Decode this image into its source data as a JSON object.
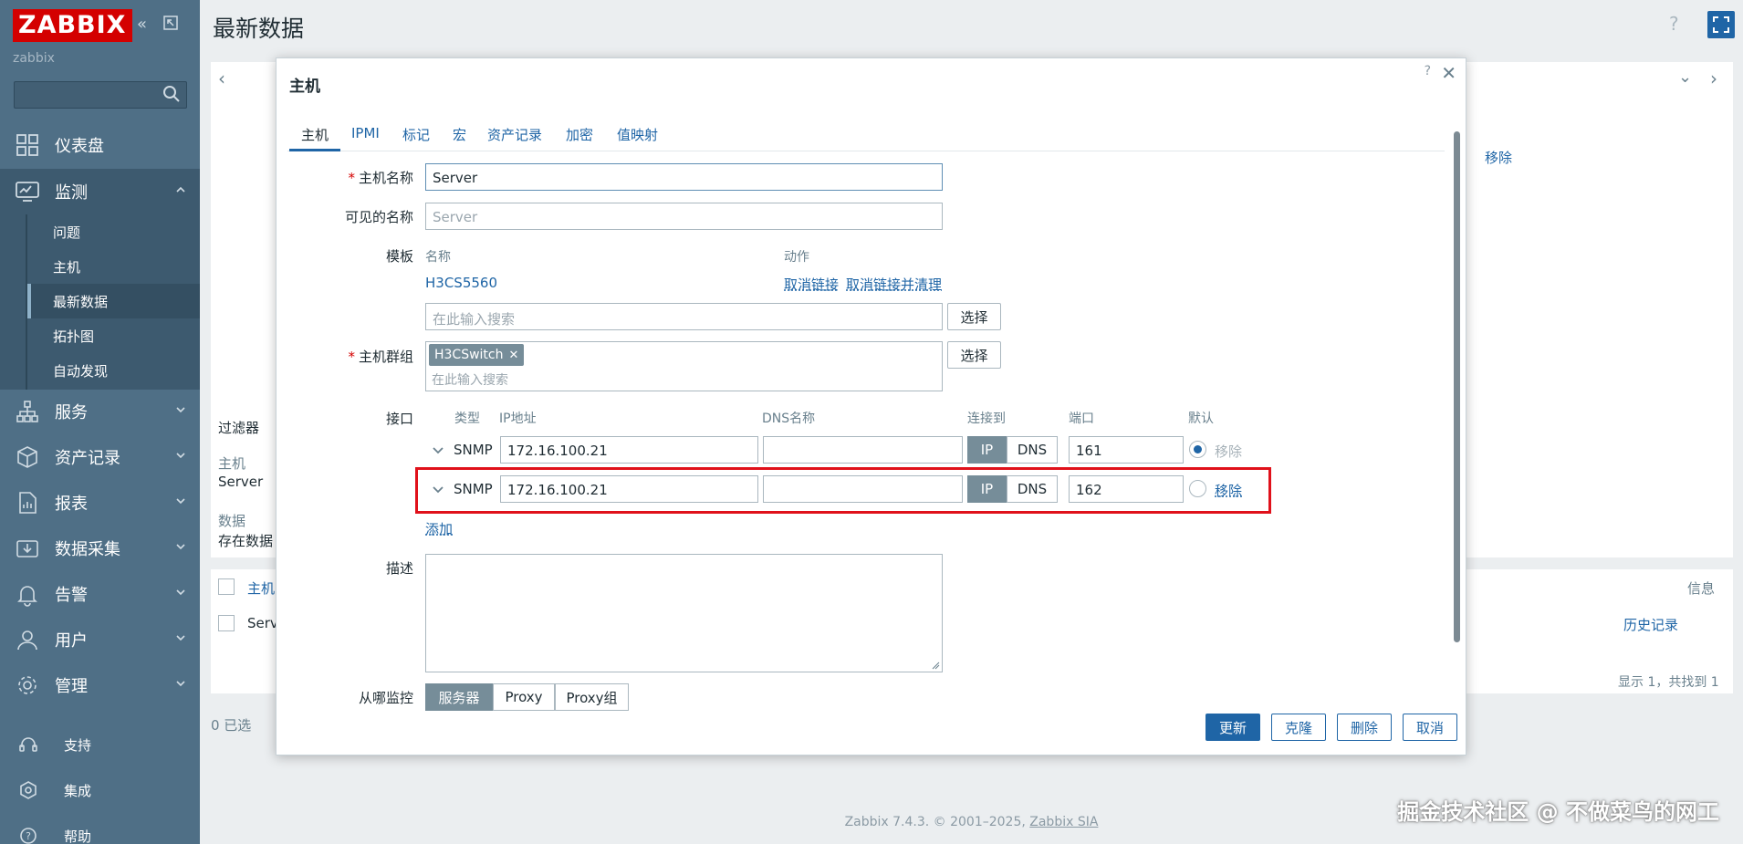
{
  "sidebar": {
    "logo": "ZABBIX",
    "server_name": "zabbix",
    "menu": [
      {
        "label": "仪表盘",
        "icon": "dashboard-icon"
      },
      {
        "label": "监测",
        "icon": "monitoring-icon"
      },
      {
        "label": "服务",
        "icon": "services-icon"
      },
      {
        "label": "资产记录",
        "icon": "inventory-icon"
      },
      {
        "label": "报表",
        "icon": "reports-icon"
      },
      {
        "label": "数据采集",
        "icon": "data-collection-icon"
      },
      {
        "label": "告警",
        "icon": "alerts-icon"
      },
      {
        "label": "用户",
        "icon": "users-icon"
      },
      {
        "label": "管理",
        "icon": "administration-icon"
      }
    ],
    "submenu": [
      "问题",
      "主机",
      "最新数据",
      "拓扑图",
      "自动发现"
    ],
    "bottom": [
      {
        "label": "支持",
        "icon": "support-icon"
      },
      {
        "label": "集成",
        "icon": "integrations-icon"
      },
      {
        "label": "帮助",
        "icon": "help-icon"
      }
    ]
  },
  "page": {
    "title": "最新数据",
    "filter_label": "过滤器",
    "bg_host_label": "主机",
    "bg_host_value": "Server",
    "bg_data_label": "数据",
    "bg_data_value": "存在数据",
    "bg_remove": "移除",
    "bg_table_host": "主机",
    "bg_table_info": "信息",
    "bg_row_host": "Serv",
    "bg_history": "历史记录",
    "bg_count": "显示 1，共找到 1",
    "bg_selected": "0 已选",
    "footer": "Zabbix 7.4.3. © 2001–2025,",
    "footer_link": "Zabbix SIA",
    "watermark": "掘金技术社区 @ 不做菜鸟的网工"
  },
  "dialog": {
    "title": "主机",
    "tabs": [
      "主机",
      "IPMI",
      "标记",
      "宏",
      "资产记录",
      "加密",
      "值映射"
    ],
    "host_name_label": "主机名称",
    "host_name_value": "Server",
    "visible_name_label": "可见的名称",
    "visible_name_placeholder": "Server",
    "templates_label": "模板",
    "templates_col_name": "名称",
    "templates_col_action": "动作",
    "template_name": "H3CS5560",
    "unlink": "取消链接",
    "unlink_clear": "取消链接并清理",
    "search_placeholder": "在此输入搜索",
    "select_button": "选择",
    "host_groups_label": "主机群组",
    "host_group_tag": "H3CSwitch",
    "interfaces_label": "接口",
    "iface_cols": {
      "type": "类型",
      "ip": "IP地址",
      "dns": "DNS名称",
      "connect": "连接到",
      "port": "端口",
      "default": "默认"
    },
    "interfaces": [
      {
        "type": "SNMP",
        "ip": "172.16.100.21",
        "dns": "",
        "connect_ip": "IP",
        "connect_dns": "DNS",
        "port": "161",
        "default": true,
        "remove": "移除"
      },
      {
        "type": "SNMP",
        "ip": "172.16.100.21",
        "dns": "",
        "connect_ip": "IP",
        "connect_dns": "DNS",
        "port": "162",
        "default": false,
        "remove": "移除"
      }
    ],
    "add_link": "添加",
    "description_label": "描述",
    "monitored_by_label": "从哪监控",
    "monitored_by": [
      "服务器",
      "Proxy",
      "Proxy组"
    ],
    "buttons": {
      "update": "更新",
      "clone": "克隆",
      "delete": "删除",
      "cancel": "取消"
    },
    "help": "?",
    "close": "✕"
  },
  "colors": {
    "sidebar": "#4f6f86",
    "accent": "#1f65a6",
    "highlight": "#e0111b",
    "logo": "#d40000"
  }
}
